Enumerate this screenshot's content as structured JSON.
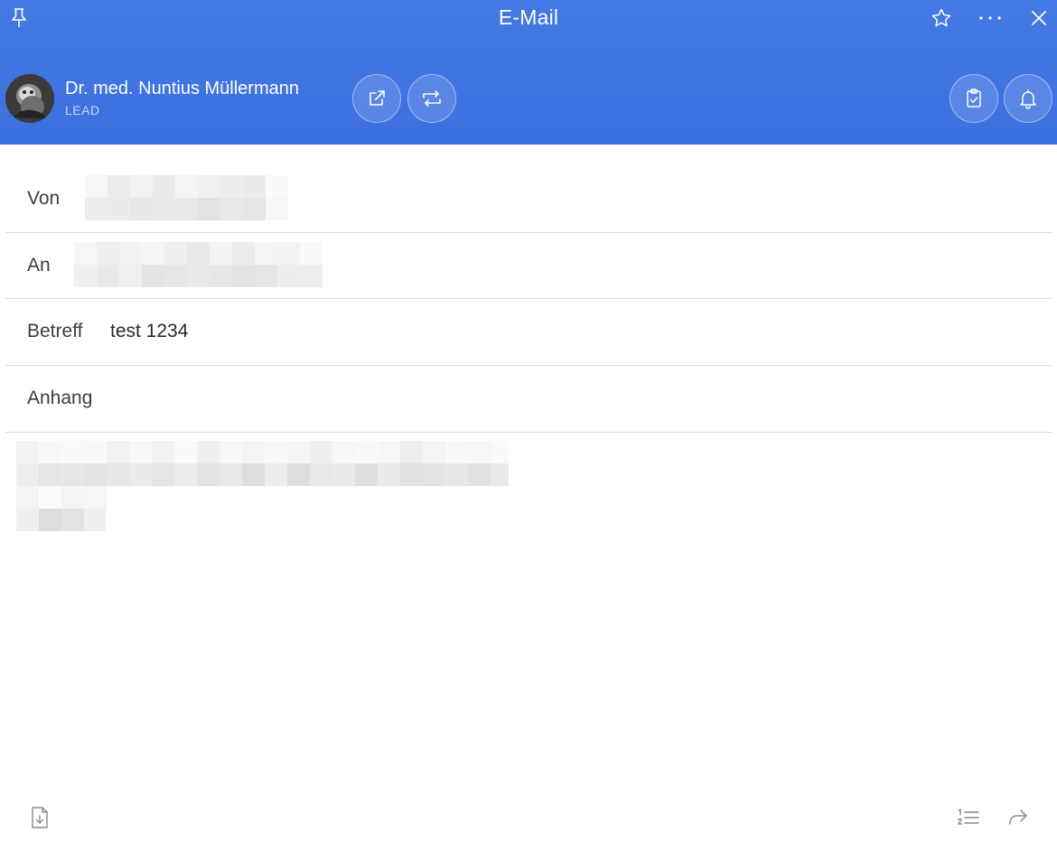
{
  "window": {
    "title": "E-Mail"
  },
  "contact": {
    "name": "Dr. med. Nuntius Müllermann",
    "role": "LEAD"
  },
  "fields": {
    "from_label": "Von",
    "to_label": "An",
    "subject_label": "Betreff",
    "subject_value": "test 1234",
    "attachment_label": "Anhang"
  },
  "icons": {
    "pin": "pin-icon",
    "favorite": "star-icon",
    "more": "more-icon",
    "close": "close-icon",
    "open_external": "external-link-icon",
    "sync": "sync-icon",
    "task": "clipboard-check-icon",
    "reminder": "bell-icon",
    "download": "file-download-icon",
    "numbered_list": "numbered-list-icon",
    "reply": "reply-icon"
  },
  "colors": {
    "header": "#3f74e1",
    "divider": "#d8d8d8"
  }
}
